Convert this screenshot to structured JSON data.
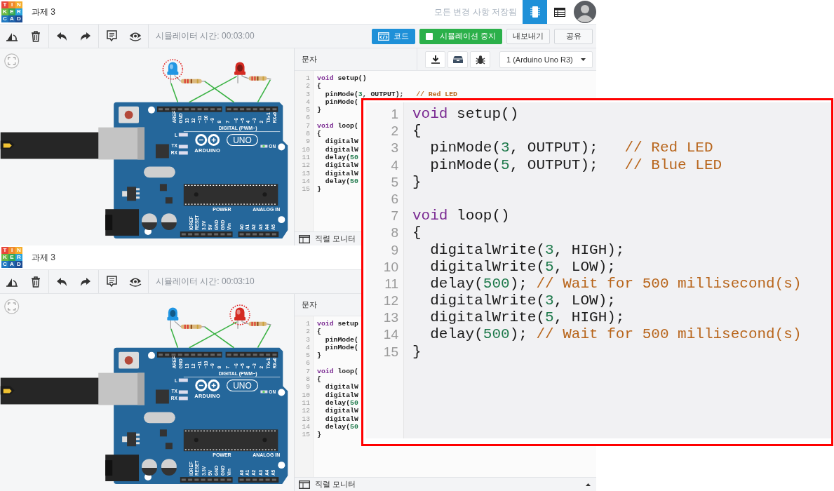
{
  "panels": [
    {
      "header": {
        "logo": [
          {
            "letter": "T",
            "color": "#e8473b"
          },
          {
            "letter": "I",
            "color": "#f08a2c"
          },
          {
            "letter": "N",
            "color": "#f5ad2b"
          },
          {
            "letter": "K",
            "color": "#6cb944"
          },
          {
            "letter": "E",
            "color": "#36a852"
          },
          {
            "letter": "R",
            "color": "#29a3dc"
          },
          {
            "letter": "C",
            "color": "#2079c2"
          },
          {
            "letter": "A",
            "color": "#1f62aa"
          },
          {
            "letter": "D",
            "color": "#1c4d95"
          }
        ],
        "title": "과제 3",
        "status": "모든 변경 사항 저장됨",
        "views": [
          {
            "kind": "circuit",
            "selected": true
          },
          {
            "kind": "table",
            "selected": false
          }
        ]
      },
      "toolbar": {
        "sim_time": "시뮬레이터 시간: 00:03:00",
        "buttons": [
          {
            "kind": "code",
            "label": "코드"
          },
          {
            "kind": "stop",
            "label": "시뮬레이션 중지"
          },
          {
            "kind": "plain",
            "label": "내보내기"
          },
          {
            "kind": "plain",
            "label": "공유"
          }
        ]
      },
      "canvas": {
        "leds": [
          {
            "color": "#2196e3",
            "on": true,
            "highlighted": true
          },
          {
            "color": "#d42a22",
            "on": false,
            "highlighted": false
          }
        ],
        "board": {
          "digital_pins": [
            "AREF",
            "GND",
            "13",
            "12",
            "~11",
            "~10",
            "~9",
            "8",
            "7",
            "~6",
            "~5",
            "4",
            "~3",
            "2",
            "TX▸1",
            "RX◂0"
          ],
          "digital_title": "DIGITAL (PWM~)",
          "led_labels": [
            "L",
            "TX",
            "RX"
          ],
          "brand": "ARDUINO",
          "model": "UNO",
          "on_label": "ON",
          "power_title": "POWER",
          "analog_title": "ANALOG IN",
          "power_pins": [
            "IOREF",
            "RESET",
            "3.3V",
            "5V",
            "GND",
            "GND",
            "Vin"
          ],
          "analog_pins": [
            "A0",
            "A1",
            "A2",
            "A3",
            "A4",
            "A5"
          ]
        }
      },
      "code": {
        "label": "문자",
        "board_select": "1 (Arduino Uno R3)",
        "serial_monitor": "직렬 모니터",
        "lines": [
          {
            "num": "1",
            "tokens": [
              {
                "text": "void",
                "kind": "keyword"
              },
              {
                "text": " setup()",
                "kind": "plain"
              }
            ]
          },
          {
            "num": "2",
            "tokens": [
              {
                "text": "{",
                "kind": "plain"
              }
            ]
          },
          {
            "num": "3",
            "tokens": [
              {
                "text": "  pinMode(",
                "kind": "plain"
              },
              {
                "text": "3",
                "kind": "number"
              },
              {
                "text": ", OUTPUT);   ",
                "kind": "plain"
              },
              {
                "text": "// Red LED",
                "kind": "comment"
              }
            ]
          },
          {
            "num": "4",
            "tokens": [
              {
                "text": "  pinMode(",
                "kind": "plain"
              }
            ]
          },
          {
            "num": "5",
            "tokens": [
              {
                "text": "}",
                "kind": "plain"
              }
            ]
          },
          {
            "num": "6"
          },
          {
            "num": "7",
            "tokens": [
              {
                "text": "void",
                "kind": "keyword"
              },
              {
                "text": " loop(",
                "kind": "plain"
              }
            ]
          },
          {
            "num": "8",
            "tokens": [
              {
                "text": "{",
                "kind": "plain"
              }
            ]
          },
          {
            "num": "9",
            "tokens": [
              {
                "text": "  digitalW",
                "kind": "plain"
              }
            ]
          },
          {
            "num": "10",
            "tokens": [
              {
                "text": "  digitalW",
                "kind": "plain"
              }
            ]
          },
          {
            "num": "11",
            "tokens": [
              {
                "text": "  delay(",
                "kind": "plain"
              },
              {
                "text": "50",
                "kind": "number"
              }
            ]
          },
          {
            "num": "12",
            "tokens": [
              {
                "text": "  digitalW",
                "kind": "plain"
              }
            ]
          },
          {
            "num": "13",
            "tokens": [
              {
                "text": "  digitalW",
                "kind": "plain"
              }
            ]
          },
          {
            "num": "14",
            "tokens": [
              {
                "text": "  delay(",
                "kind": "plain"
              },
              {
                "text": "50",
                "kind": "number"
              }
            ]
          },
          {
            "num": "15",
            "tokens": [
              {
                "text": "}",
                "kind": "plain"
              }
            ]
          }
        ]
      }
    },
    {
      "header": {
        "logo": [
          {
            "letter": "T",
            "color": "#e8473b"
          },
          {
            "letter": "I",
            "color": "#f08a2c"
          },
          {
            "letter": "N",
            "color": "#f5ad2b"
          },
          {
            "letter": "K",
            "color": "#6cb944"
          },
          {
            "letter": "E",
            "color": "#36a852"
          },
          {
            "letter": "R",
            "color": "#29a3dc"
          },
          {
            "letter": "C",
            "color": "#2079c2"
          },
          {
            "letter": "A",
            "color": "#1f62aa"
          },
          {
            "letter": "D",
            "color": "#1c4d95"
          }
        ],
        "title": "과제 3"
      },
      "toolbar": {
        "sim_time": "시뮬레이터 시간: 00:03:10"
      },
      "canvas": {
        "leds": [
          {
            "color": "#2196e3",
            "on": false,
            "highlighted": false
          },
          {
            "color": "#d42a22",
            "on": true,
            "highlighted": true
          }
        ],
        "board": {
          "digital_pins": [
            "AREF",
            "GND",
            "13",
            "12",
            "~11",
            "~10",
            "~9",
            "8",
            "7",
            "~6",
            "~5",
            "4",
            "~3",
            "2",
            "TX▸1",
            "RX◂0"
          ],
          "digital_title": "DIGITAL (PWM~)",
          "led_labels": [
            "L",
            "TX",
            "RX"
          ],
          "brand": "ARDUINO",
          "model": "UNO",
          "on_label": "ON",
          "power_title": "POWER",
          "analog_title": "ANALOG IN",
          "power_pins": [
            "IOREF",
            "RESET",
            "3.3V",
            "5V",
            "GND",
            "GND",
            "Vin"
          ],
          "analog_pins": [
            "A0",
            "A1",
            "A2",
            "A3",
            "A4",
            "A5"
          ]
        }
      },
      "code": {
        "label": "문자",
        "serial_monitor": "직렬 모니터",
        "expand_caret": true,
        "lines": [
          {
            "num": "1",
            "tokens": [
              {
                "text": "void",
                "kind": "keyword"
              },
              {
                "text": " setup",
                "kind": "plain"
              }
            ]
          },
          {
            "num": "2",
            "tokens": [
              {
                "text": "{",
                "kind": "plain"
              }
            ]
          },
          {
            "num": "3",
            "tokens": [
              {
                "text": "  pinMode(",
                "kind": "plain"
              }
            ]
          },
          {
            "num": "4",
            "tokens": [
              {
                "text": "  pinMode(",
                "kind": "plain"
              }
            ]
          },
          {
            "num": "5",
            "tokens": [
              {
                "text": "}",
                "kind": "plain"
              }
            ]
          },
          {
            "num": "6"
          },
          {
            "num": "7",
            "tokens": [
              {
                "text": "void",
                "kind": "keyword"
              },
              {
                "text": " loop(",
                "kind": "plain"
              }
            ]
          },
          {
            "num": "8",
            "tokens": [
              {
                "text": "{",
                "kind": "plain"
              }
            ]
          },
          {
            "num": "9",
            "tokens": [
              {
                "text": "  digitalW",
                "kind": "plain"
              }
            ]
          },
          {
            "num": "10",
            "tokens": [
              {
                "text": "  digitalW",
                "kind": "plain"
              }
            ]
          },
          {
            "num": "11",
            "tokens": [
              {
                "text": "  delay(",
                "kind": "plain"
              },
              {
                "text": "50",
                "kind": "number"
              }
            ]
          },
          {
            "num": "12",
            "tokens": [
              {
                "text": "  digitalW",
                "kind": "plain"
              }
            ]
          },
          {
            "num": "13",
            "tokens": [
              {
                "text": "  digitalW",
                "kind": "plain"
              }
            ]
          },
          {
            "num": "14",
            "tokens": [
              {
                "text": "  delay(",
                "kind": "plain"
              },
              {
                "text": "50",
                "kind": "number"
              }
            ]
          },
          {
            "num": "15",
            "tokens": [
              {
                "text": "}",
                "kind": "plain"
              }
            ]
          }
        ]
      }
    }
  ],
  "zoomed_code": {
    "lines": [
      {
        "num": "1",
        "tokens": [
          {
            "text": "void",
            "kind": "keyword"
          },
          {
            "text": " setup()",
            "kind": "plain"
          }
        ]
      },
      {
        "num": "2",
        "tokens": [
          {
            "text": "{",
            "kind": "plain"
          }
        ]
      },
      {
        "num": "3",
        "tokens": [
          {
            "text": "  pinMode(",
            "kind": "plain"
          },
          {
            "text": "3",
            "kind": "number"
          },
          {
            "text": ", OUTPUT);   ",
            "kind": "plain"
          },
          {
            "text": "// Red LED",
            "kind": "comment"
          }
        ]
      },
      {
        "num": "4",
        "tokens": [
          {
            "text": "  pinMode(",
            "kind": "plain"
          },
          {
            "text": "5",
            "kind": "number"
          },
          {
            "text": ", OUTPUT);   ",
            "kind": "plain"
          },
          {
            "text": "// Blue LED",
            "kind": "comment"
          }
        ]
      },
      {
        "num": "5",
        "tokens": [
          {
            "text": "}",
            "kind": "plain"
          }
        ]
      },
      {
        "num": "6"
      },
      {
        "num": "7",
        "tokens": [
          {
            "text": "void",
            "kind": "keyword"
          },
          {
            "text": " loop()",
            "kind": "plain"
          }
        ]
      },
      {
        "num": "8",
        "tokens": [
          {
            "text": "{",
            "kind": "plain"
          }
        ]
      },
      {
        "num": "9",
        "tokens": [
          {
            "text": "  digitalWrite(",
            "kind": "plain"
          },
          {
            "text": "3",
            "kind": "number"
          },
          {
            "text": ", HIGH);",
            "kind": "plain"
          }
        ]
      },
      {
        "num": "10",
        "tokens": [
          {
            "text": "  digitalWrite(",
            "kind": "plain"
          },
          {
            "text": "5",
            "kind": "number"
          },
          {
            "text": ", LOW);",
            "kind": "plain"
          }
        ]
      },
      {
        "num": "11",
        "tokens": [
          {
            "text": "  delay(",
            "kind": "plain"
          },
          {
            "text": "500",
            "kind": "number"
          },
          {
            "text": "); ",
            "kind": "plain"
          },
          {
            "text": "// Wait for 500 millisecond(s)",
            "kind": "comment"
          }
        ]
      },
      {
        "num": "12",
        "tokens": [
          {
            "text": "  digitalWrite(",
            "kind": "plain"
          },
          {
            "text": "3",
            "kind": "number"
          },
          {
            "text": ", LOW);",
            "kind": "plain"
          }
        ]
      },
      {
        "num": "13",
        "tokens": [
          {
            "text": "  digitalWrite(",
            "kind": "plain"
          },
          {
            "text": "5",
            "kind": "number"
          },
          {
            "text": ", HIGH);",
            "kind": "plain"
          }
        ]
      },
      {
        "num": "14",
        "tokens": [
          {
            "text": "  delay(",
            "kind": "plain"
          },
          {
            "text": "500",
            "kind": "number"
          },
          {
            "text": "); ",
            "kind": "plain"
          },
          {
            "text": "// Wait for 500 millisecond(s)",
            "kind": "comment"
          }
        ]
      },
      {
        "num": "15",
        "tokens": [
          {
            "text": "}",
            "kind": "plain"
          }
        ]
      }
    ]
  }
}
